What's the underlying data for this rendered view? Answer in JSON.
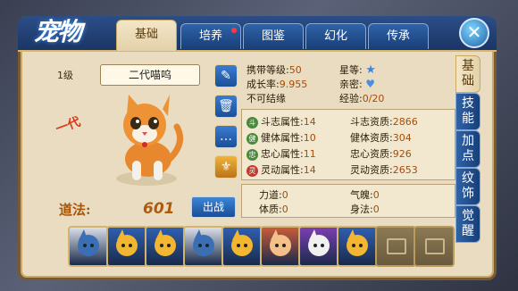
{
  "window": {
    "title": "宠物",
    "close_icon": "close-x-icon"
  },
  "tabs": [
    {
      "label": "基础",
      "active": true
    },
    {
      "label": "培养",
      "notice": true
    },
    {
      "label": "图鉴"
    },
    {
      "label": "幻化"
    },
    {
      "label": "传承"
    }
  ],
  "side_tabs": [
    "基础",
    "技能",
    "加点",
    "纹饰",
    "觉醒"
  ],
  "pet": {
    "level": "1级",
    "name": "二代喵呜",
    "tier_badge": "一代",
    "daoxing_label": "道法:",
    "daoxing_value": "601",
    "fight_label": "出战"
  },
  "tools": [
    {
      "icon": "rename-brush-icon"
    },
    {
      "icon": "trash-icon"
    },
    {
      "icon": "chat-icon"
    },
    {
      "icon": "wings-icon"
    }
  ],
  "info": {
    "carry_level": {
      "label": "携带等级:",
      "value": "50"
    },
    "growth": {
      "label": "成长率:",
      "value": "9.955"
    },
    "no_bind": "不可结缘",
    "star": {
      "label": "星等:"
    },
    "intimacy": {
      "label": "亲密:"
    },
    "exp": {
      "label": "经验:",
      "value": "0/20"
    }
  },
  "attributes": [
    {
      "icon": "斗",
      "icon_color": "#4a8a3c",
      "attr_label": "斗志属性:",
      "attr_value": "14",
      "apt_label": "斗志资质:",
      "apt_value": "2866"
    },
    {
      "icon": "健",
      "icon_color": "#4a8a3c",
      "attr_label": "健体属性:",
      "attr_value": "10",
      "apt_label": "健体资质:",
      "apt_value": "304"
    },
    {
      "icon": "忠",
      "icon_color": "#4a8a3c",
      "attr_label": "忠心属性:",
      "attr_value": "11",
      "apt_label": "忠心资质:",
      "apt_value": "926"
    },
    {
      "icon": "灵",
      "icon_color": "#c23a2a",
      "attr_label": "灵动属性:",
      "attr_value": "14",
      "apt_label": "灵动资质:",
      "apt_value": "2653"
    }
  ],
  "bonus": [
    {
      "label": "力道:",
      "value": "0",
      "label2": "气魄:",
      "value2": "0"
    },
    {
      "label": "体质:",
      "value": "0",
      "label2": "身法:",
      "value2": "0"
    }
  ],
  "slots": [
    {
      "type": "pet",
      "color": "#d9dfe9",
      "accent": "#3b6fb5"
    },
    {
      "type": "pet",
      "color": "#2f5fb0",
      "accent": "#f2b631"
    },
    {
      "type": "pet",
      "color": "#2f5fb0",
      "accent": "#f2b631"
    },
    {
      "type": "pet",
      "color": "#d9dfe9",
      "accent": "#3b6fb5"
    },
    {
      "type": "pet",
      "color": "#2f5fb0",
      "accent": "#f2b631"
    },
    {
      "type": "pet",
      "color": "#c85a3a",
      "accent": "#f3c08a"
    },
    {
      "type": "pet",
      "color": "#7a3fb0",
      "accent": "#f0f0f0"
    },
    {
      "type": "pet",
      "color": "#2f5fb0",
      "accent": "#f2b631"
    },
    {
      "type": "empty"
    },
    {
      "type": "empty"
    }
  ],
  "colors": {
    "accent_blue": "#1b3566",
    "panel": "#e9dcc0",
    "value": "#a54c0c"
  }
}
